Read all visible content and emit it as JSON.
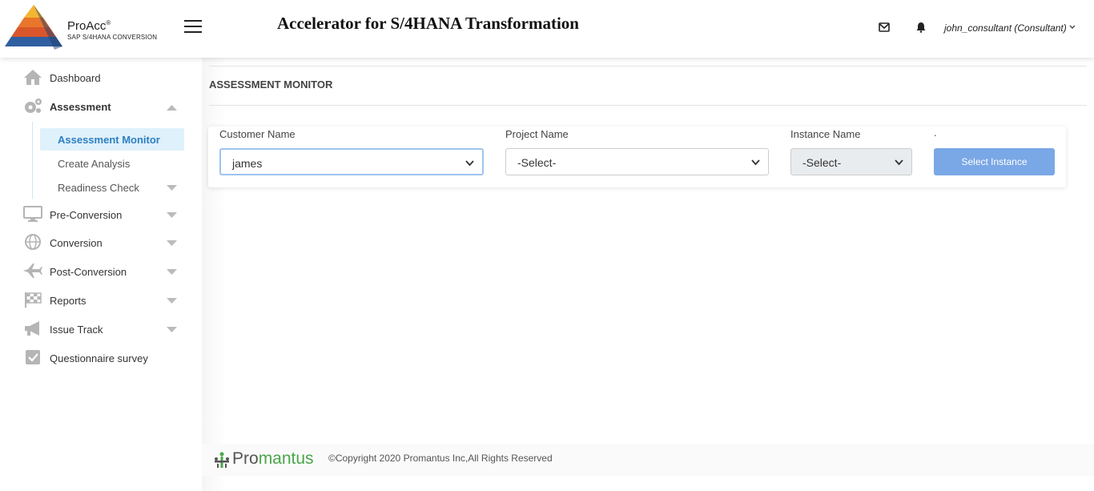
{
  "brand": {
    "name": "ProAcc",
    "reg": "®",
    "tagline": "SAP S/4HANA CONVERSION"
  },
  "header": {
    "title": "Accelerator for S/4HANA Transformation",
    "user": "john_consultant (Consultant)",
    "icons": [
      "mail-icon",
      "bell-icon",
      "chevron-down-icon",
      "hamburger-menu-icon"
    ]
  },
  "sidebar": {
    "items": [
      {
        "label": "Dashboard",
        "icon": "home-icon"
      },
      {
        "label": "Assessment",
        "icon": "gears-icon"
      },
      {
        "label": "Pre-Conversion",
        "icon": "monitor-icon"
      },
      {
        "label": "Conversion",
        "icon": "globe-icon"
      },
      {
        "label": "Post-Conversion",
        "icon": "plane-icon"
      },
      {
        "label": "Reports",
        "icon": "checkered-flag-icon"
      },
      {
        "label": "Issue Track",
        "icon": "megaphone-icon"
      },
      {
        "label": "Questionnaire survey",
        "icon": "checkbox-icon"
      }
    ],
    "assessment_sub": [
      {
        "label": "Assessment Monitor",
        "active": true
      },
      {
        "label": "Create Analysis"
      },
      {
        "label": "Readiness Check"
      }
    ]
  },
  "main": {
    "page_title": "ASSESSMENT MONITOR",
    "fields": {
      "customer": {
        "label": "Customer Name",
        "value": "james"
      },
      "project": {
        "label": "Project Name",
        "value": "-Select-"
      },
      "instance": {
        "label": "Instance Name",
        "value": "-Select-"
      },
      "button_label_prefix": "."
    },
    "select_instance_label": "Select Instance"
  },
  "footer": {
    "logo_pro": "Pro",
    "logo_mantus": "mantus",
    "copyright": "©Copyright 2020 Promantus Inc,All Rights Reserved"
  },
  "colors": {
    "accent": "#2d7fc1",
    "active_bg": "#dff1fb",
    "button": "#7aa7e6",
    "footer_logo_green": "#4aa64a"
  }
}
